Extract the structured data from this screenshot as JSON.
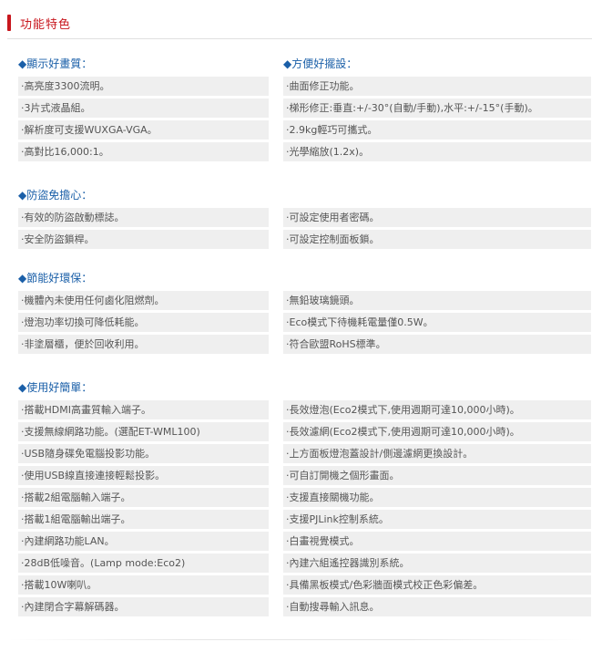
{
  "header": {
    "title": "功能特色",
    "accent_color": "#c8161d"
  },
  "sections": {
    "display": {
      "title": "◆顯示好畫質：",
      "items": [
        "·高亮度3300流明。",
        "·3片式液晶組。",
        "·解析度可支援WUXGA-VGA。",
        "·高對比16,000:1。"
      ]
    },
    "convenient": {
      "title": "◆方便好擺設：",
      "items": [
        "·曲面修正功能。",
        "·梯形修正:垂直:+/-30°(自動/手動),水平:+/-15°(手動)。",
        "·2.9kg輕巧可攜式。",
        "·光學縮放(1.2x)。"
      ]
    },
    "antitheft": {
      "title": "◆防盜免擔心：",
      "left": [
        "·有效的防盜啟動標誌。",
        "·安全防盜鎖桿。"
      ],
      "right": [
        "·可設定使用者密碼。",
        "·可設定控制面板鎖。"
      ]
    },
    "eco": {
      "title": "◆節能好環保：",
      "left": [
        "·機體內未使用任何鹵化阻燃劑。",
        "·燈泡功率切換可降低耗能。",
        "·非塗層櫃，便於回收利用。"
      ],
      "right": [
        "·無鉛玻璃鏡頭。",
        "·Eco模式下待機耗電量僅0.5W。",
        "·符合歐盟RoHS標準。"
      ]
    },
    "easy": {
      "title": "◆使用好簡單：",
      "left": [
        "·搭載HDMI高畫質輸入端子。",
        "·支援無線網路功能。(選配ET-WML100)",
        "·USB隨身碟免電腦投影功能。",
        "·使用USB線直接連接輕鬆投影。",
        "·搭載2組電腦輸入端子。",
        "·搭載1組電腦輸出端子。",
        "·內建網路功能LAN。",
        "·28dB低噪音。(Lamp mode:Eco2)",
        "·搭載10W喇叭。",
        "·內建閉合字幕解碼器。"
      ],
      "right": [
        "·長效燈泡(Eco2模式下,使用週期可達10,000小時)。",
        "·長效濾網(Eco2模式下,使用週期可達10,000小時)。",
        "·上方面板燈泡蓋設計/側邊濾網更換設計。",
        "·可自訂開機之個形畫面。",
        "·支援直接關機功能。",
        "·支援PJLink控制系統。",
        "·白畫視覺模式。",
        "·內建六組遙控器識別系統。",
        "·具備黑板模式/色彩牆面模式校正色彩偏差。",
        "·自動搜尋輸入訊息。"
      ]
    }
  },
  "colors": {
    "section_title": "#1a5fa8",
    "cell_bg": "#efefef",
    "text": "#555555"
  }
}
